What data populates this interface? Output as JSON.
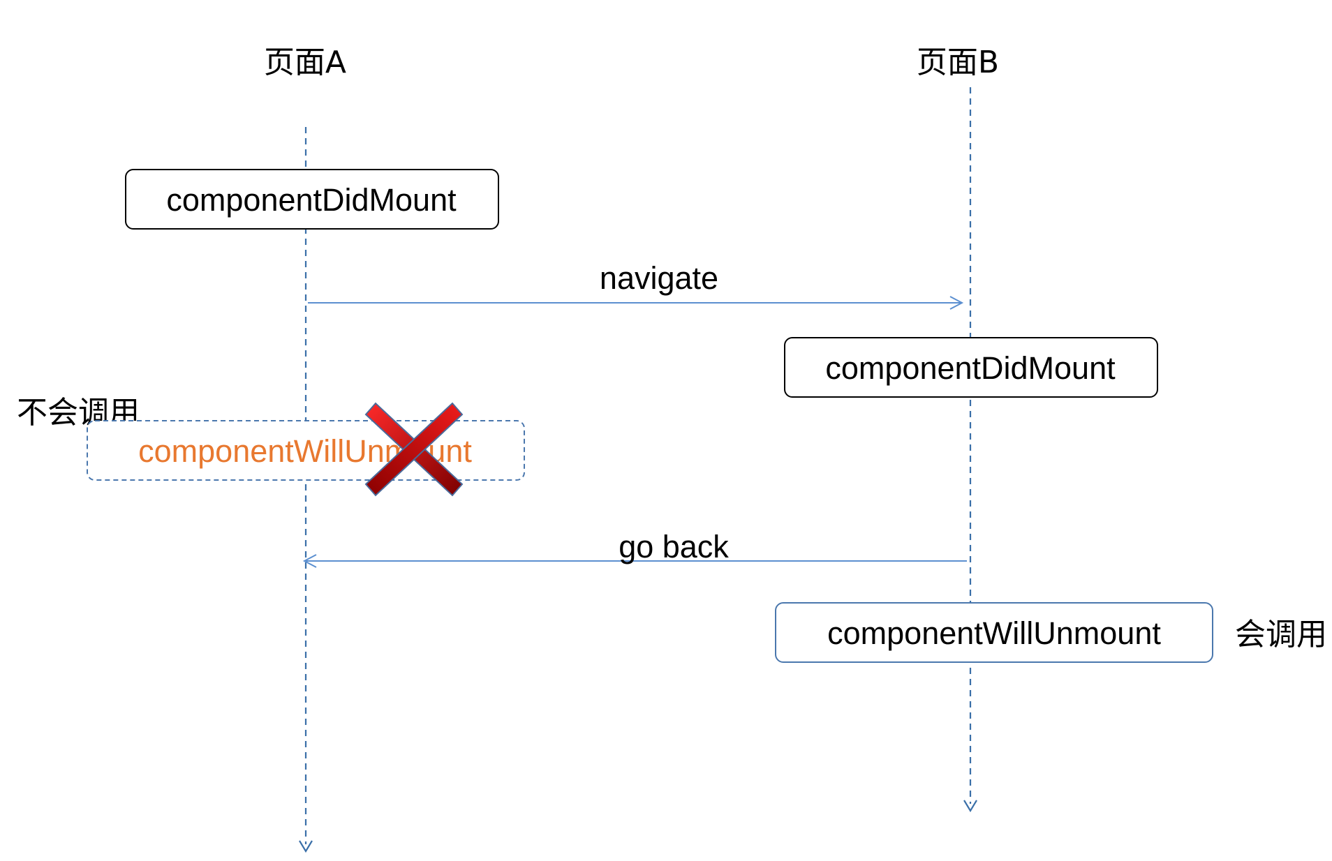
{
  "lanes": {
    "a": {
      "title": "页面A"
    },
    "b": {
      "title": "页面B"
    }
  },
  "boxes": {
    "a_did_mount": "componentDidMount",
    "b_did_mount": "componentDidMount",
    "a_will_unmount": "componentWillUnmount",
    "b_will_unmount": "componentWillUnmount"
  },
  "edges": {
    "navigate": "navigate",
    "go_back": "go back"
  },
  "notes": {
    "not_called": "不会调用",
    "called": "会调用"
  },
  "colors": {
    "lifeline": "#3a6fa8",
    "arrow": "#5b8fd0",
    "box_border_black": "#000000",
    "box_border_blue": "#4a77ad",
    "crossed_text": "#e8782f",
    "cross_red": "#cc1111"
  },
  "icons": {
    "cross": "red-x-cross-icon"
  }
}
